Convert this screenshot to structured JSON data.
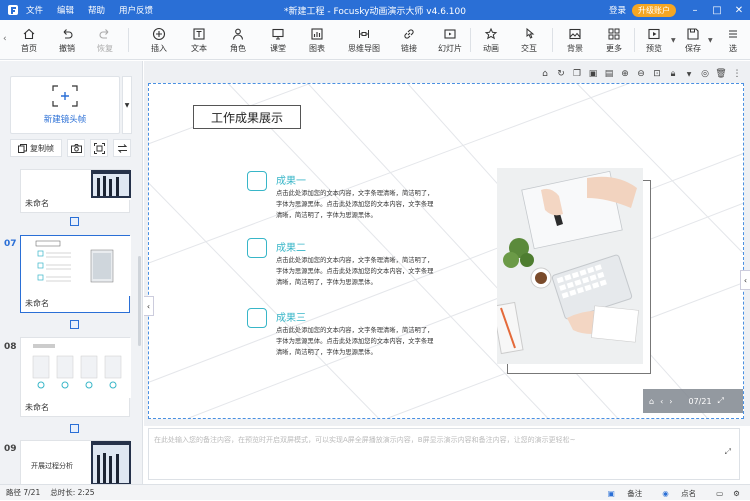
{
  "app": {
    "title": "*新建工程 - Focusky动画演示大师  v4.6.100",
    "menu": [
      "文件",
      "编辑",
      "帮助",
      "用户反馈"
    ],
    "login": "登录",
    "upgrade": "升级账户"
  },
  "toolbar": {
    "home": "首页",
    "undo": "撤销",
    "redo": "恢复",
    "insert": "插入",
    "text": "文本",
    "shape": "角色",
    "course": "课堂",
    "chart": "图表",
    "mindmap": "思维导图",
    "link": "链接",
    "slides": "幻灯片",
    "animation": "动画",
    "interact": "交互",
    "background": "背景",
    "more": "更多",
    "preview": "预览",
    "save": "保存",
    "options": "选"
  },
  "left": {
    "new_frame": "新建镜头帧",
    "copy_frame": "复制帧",
    "thumbs": [
      {
        "num": "",
        "name": "未命名"
      },
      {
        "num": "07",
        "name": "未命名"
      },
      {
        "num": "08",
        "name": "未命名"
      },
      {
        "num": "09",
        "name": "",
        "caption": "开展过程分析"
      }
    ]
  },
  "slide": {
    "title": "工作成果展示",
    "items": [
      {
        "title": "成果一",
        "text": [
          "点击此处添加您的文本内容，文字条理清晰，简洁明了，",
          "字体为思源黑体。点击此处添加您的文本内容，文字条理",
          "清晰，简洁明了，字体为思源黑体。"
        ]
      },
      {
        "title": "成果二",
        "text": [
          "点击此处添加您的文本内容，文字条理清晰，简洁明了，",
          "字体为思源黑体。点击此处添加您的文本内容，文字条理",
          "清晰，简洁明了，字体为思源黑体。"
        ]
      },
      {
        "title": "成果三",
        "text": [
          "点击此处添加您的文本内容，文字条理清晰，简洁明了，",
          "字体为思源黑体。点击此处添加您的文本内容，文字条理",
          "清晰，简洁明了，字体为思源黑体。"
        ]
      }
    ],
    "page_indicator": "07/21"
  },
  "notes": {
    "placeholder": "在此处输入您的备注内容，在预览时开启双屏模式，可以实现A屏全屏播放演示内容，B屏显示演示内容和备注内容，让您的演示更轻松~"
  },
  "status": {
    "path": "路径 7/21",
    "duration": "总时长: 2:25",
    "notes": "备注",
    "roll": "点名"
  },
  "colors": {
    "brand": "#2a6fd6",
    "accent": "#38b6c8",
    "upgrade": "#f5a623"
  }
}
